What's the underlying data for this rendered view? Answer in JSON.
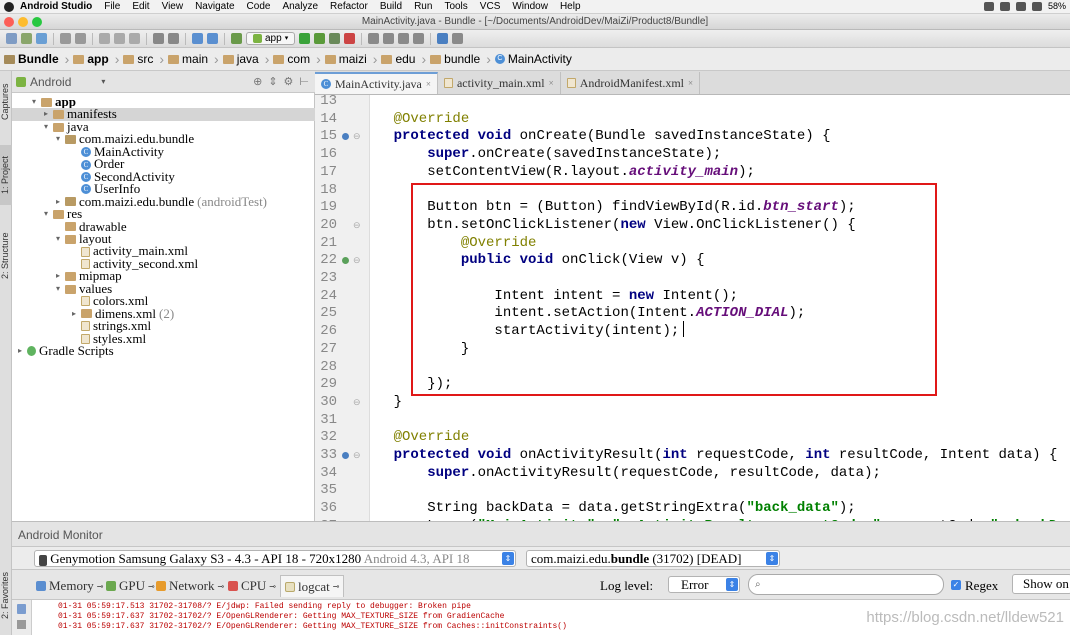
{
  "menubar": {
    "items": [
      "Android Studio",
      "File",
      "Edit",
      "View",
      "Navigate",
      "Code",
      "Analyze",
      "Refactor",
      "Build",
      "Run",
      "Tools",
      "VCS",
      "Window",
      "Help"
    ],
    "battery": "58%"
  },
  "window": {
    "title": "MainActivity.java - Bundle - [~/Documents/AndroidDev/MaiZi/Product8/Bundle]"
  },
  "toolbar": {
    "run_config": "app"
  },
  "breadcrumb": [
    "Bundle",
    "app",
    "src",
    "main",
    "java",
    "com",
    "maizi",
    "edu",
    "bundle",
    "MainActivity"
  ],
  "side_tabs": {
    "captures": "Captures",
    "project": "1: Project",
    "structure": "2: Structure",
    "favorites": "2: Favorites"
  },
  "project": {
    "view": "Android",
    "tree": [
      {
        "label": "app",
        "arrow": "▾",
        "icon": "folder",
        "bold": true
      },
      {
        "label": "manifests",
        "arrow": "▸",
        "icon": "folder"
      },
      {
        "label": "java",
        "arrow": "▾",
        "icon": "folder"
      },
      {
        "label": "com.maizi.edu.bundle",
        "arrow": "▾",
        "icon": "package"
      },
      {
        "label": "MainActivity",
        "icon": "class"
      },
      {
        "label": "Order",
        "icon": "class"
      },
      {
        "label": "SecondActivity",
        "icon": "class"
      },
      {
        "label": "UserInfo",
        "icon": "class"
      },
      {
        "label": "com.maizi.edu.bundle",
        "suffix": "(androidTest)",
        "arrow": "▸",
        "icon": "package"
      },
      {
        "label": "res",
        "arrow": "▾",
        "icon": "folder"
      },
      {
        "label": "drawable",
        "icon": "folder"
      },
      {
        "label": "layout",
        "arrow": "▾",
        "icon": "folder"
      },
      {
        "label": "activity_main.xml",
        "icon": "xml"
      },
      {
        "label": "activity_second.xml",
        "icon": "xml"
      },
      {
        "label": "mipmap",
        "arrow": "▸",
        "icon": "folder"
      },
      {
        "label": "values",
        "arrow": "▾",
        "icon": "folder"
      },
      {
        "label": "colors.xml",
        "icon": "xml"
      },
      {
        "label": "dimens.xml",
        "suffix": "(2)",
        "arrow": "▸",
        "icon": "folder"
      },
      {
        "label": "strings.xml",
        "icon": "xml"
      },
      {
        "label": "styles.xml",
        "icon": "xml"
      },
      {
        "label": "Gradle Scripts",
        "arrow": "▸",
        "icon": "gradle"
      }
    ]
  },
  "editor": {
    "tabs": [
      {
        "label": "MainActivity.java",
        "active": true
      },
      {
        "label": "activity_main.xml",
        "active": false
      },
      {
        "label": "AndroidManifest.xml",
        "active": false
      }
    ],
    "lines": [
      {
        "n": "13",
        "t": []
      },
      {
        "n": "14",
        "t": [
          {
            "c": "an",
            "s": "    @Override"
          }
        ]
      },
      {
        "n": "15",
        "t": [
          {
            "c": "kw",
            "s": "    protected void "
          },
          {
            "c": "",
            "s": "onCreate(Bundle savedInstanceState) {"
          }
        ]
      },
      {
        "n": "16",
        "t": [
          {
            "c": "kw",
            "s": "        super"
          },
          {
            "c": "",
            "s": ".onCreate(savedInstanceState);"
          }
        ]
      },
      {
        "n": "17",
        "t": [
          {
            "c": "",
            "s": "        setContentView(R.layout."
          },
          {
            "c": "fld",
            "s": "activity_main"
          },
          {
            "c": "",
            "s": ");"
          }
        ]
      },
      {
        "n": "18",
        "t": []
      },
      {
        "n": "19",
        "t": [
          {
            "c": "",
            "s": "        Button btn = (Button) findViewById(R.id."
          },
          {
            "c": "fld",
            "s": "btn_start"
          },
          {
            "c": "",
            "s": ");"
          }
        ]
      },
      {
        "n": "20",
        "t": [
          {
            "c": "",
            "s": "        btn.setOnClickListener("
          },
          {
            "c": "kw",
            "s": "new "
          },
          {
            "c": "",
            "s": "View.OnClickListener() {"
          }
        ]
      },
      {
        "n": "21",
        "t": [
          {
            "c": "an",
            "s": "            @Override"
          }
        ]
      },
      {
        "n": "22",
        "t": [
          {
            "c": "kw",
            "s": "            public void "
          },
          {
            "c": "",
            "s": "onClick(View v) {"
          }
        ]
      },
      {
        "n": "23",
        "t": []
      },
      {
        "n": "24",
        "t": [
          {
            "c": "",
            "s": "                Intent intent = "
          },
          {
            "c": "kw",
            "s": "new "
          },
          {
            "c": "",
            "s": "Intent();"
          }
        ]
      },
      {
        "n": "25",
        "t": [
          {
            "c": "",
            "s": "                intent.setAction(Intent."
          },
          {
            "c": "fld",
            "s": "ACTION_DIAL"
          },
          {
            "c": "",
            "s": ");"
          }
        ]
      },
      {
        "n": "26",
        "t": [
          {
            "c": "",
            "s": "                startActivity(intent);"
          }
        ]
      },
      {
        "n": "27",
        "t": [
          {
            "c": "",
            "s": "            }"
          }
        ]
      },
      {
        "n": "28",
        "t": []
      },
      {
        "n": "29",
        "t": [
          {
            "c": "",
            "s": "        });"
          }
        ]
      },
      {
        "n": "30",
        "t": [
          {
            "c": "",
            "s": "    }"
          }
        ]
      },
      {
        "n": "31",
        "t": []
      },
      {
        "n": "32",
        "t": [
          {
            "c": "an",
            "s": "    @Override"
          }
        ]
      },
      {
        "n": "33",
        "t": [
          {
            "c": "kw",
            "s": "    protected void "
          },
          {
            "c": "",
            "s": "onActivityResult("
          },
          {
            "c": "kw",
            "s": "int "
          },
          {
            "c": "",
            "s": "requestCode, "
          },
          {
            "c": "kw",
            "s": "int "
          },
          {
            "c": "",
            "s": "resultCode, Intent data) {"
          }
        ]
      },
      {
        "n": "34",
        "t": [
          {
            "c": "kw",
            "s": "        super"
          },
          {
            "c": "",
            "s": ".onActivityResult(requestCode, resultCode, data);"
          }
        ]
      },
      {
        "n": "35",
        "t": []
      },
      {
        "n": "36",
        "t": [
          {
            "c": "",
            "s": "        String backData = data.getStringExtra("
          },
          {
            "c": "str",
            "s": "\"back_data\""
          },
          {
            "c": "",
            "s": ");"
          }
        ]
      },
      {
        "n": "37",
        "t": [
          {
            "c": "",
            "s": "        Log.e("
          },
          {
            "c": "str",
            "s": "\"MainActivity\""
          },
          {
            "c": "",
            "s": ", "
          },
          {
            "c": "str",
            "s": "\"onActivityResult, requestCode=\""
          },
          {
            "c": "",
            "s": "+requestCode+"
          },
          {
            "c": "str",
            "s": "\", backDa"
          }
        ]
      }
    ]
  },
  "monitor": {
    "title": "Android Monitor",
    "device": "Genymotion Samsung Galaxy S3 - 4.3 - API 18 - 720x1280",
    "device_dim": "Android 4.3, API 18",
    "process_prefix": "com.maizi.edu.",
    "process_bold": "bundle",
    "process_suffix": "(31702) [DEAD]",
    "tabs": [
      "Memory",
      "GPU",
      "Network",
      "CPU",
      "logcat"
    ],
    "log_level_label": "Log level:",
    "log_level": "Error",
    "search_placeholder": "",
    "regex_label": "Regex",
    "show_only": "Show on",
    "log_lines": [
      "01-31 05:59:17.513 31702-31708/? E/jdwp: Failed sending reply to debugger: Broken pipe",
      "01-31 05:59:17.637 31702-31702/? E/OpenGLRenderer: Getting MAX_TEXTURE_SIZE from GradienCache",
      "01-31 05:59:17.637 31702-31702/? E/OpenGLRenderer: Getting MAX_TEXTURE_SIZE from Caches::initConstraints()"
    ]
  },
  "watermark": "https://blog.csdn.net/lldew521",
  "colors": {
    "highlight_box": "#e01818",
    "keyword": "#000080",
    "field": "#660e7a",
    "annotation": "#808000",
    "string": "#008000"
  }
}
